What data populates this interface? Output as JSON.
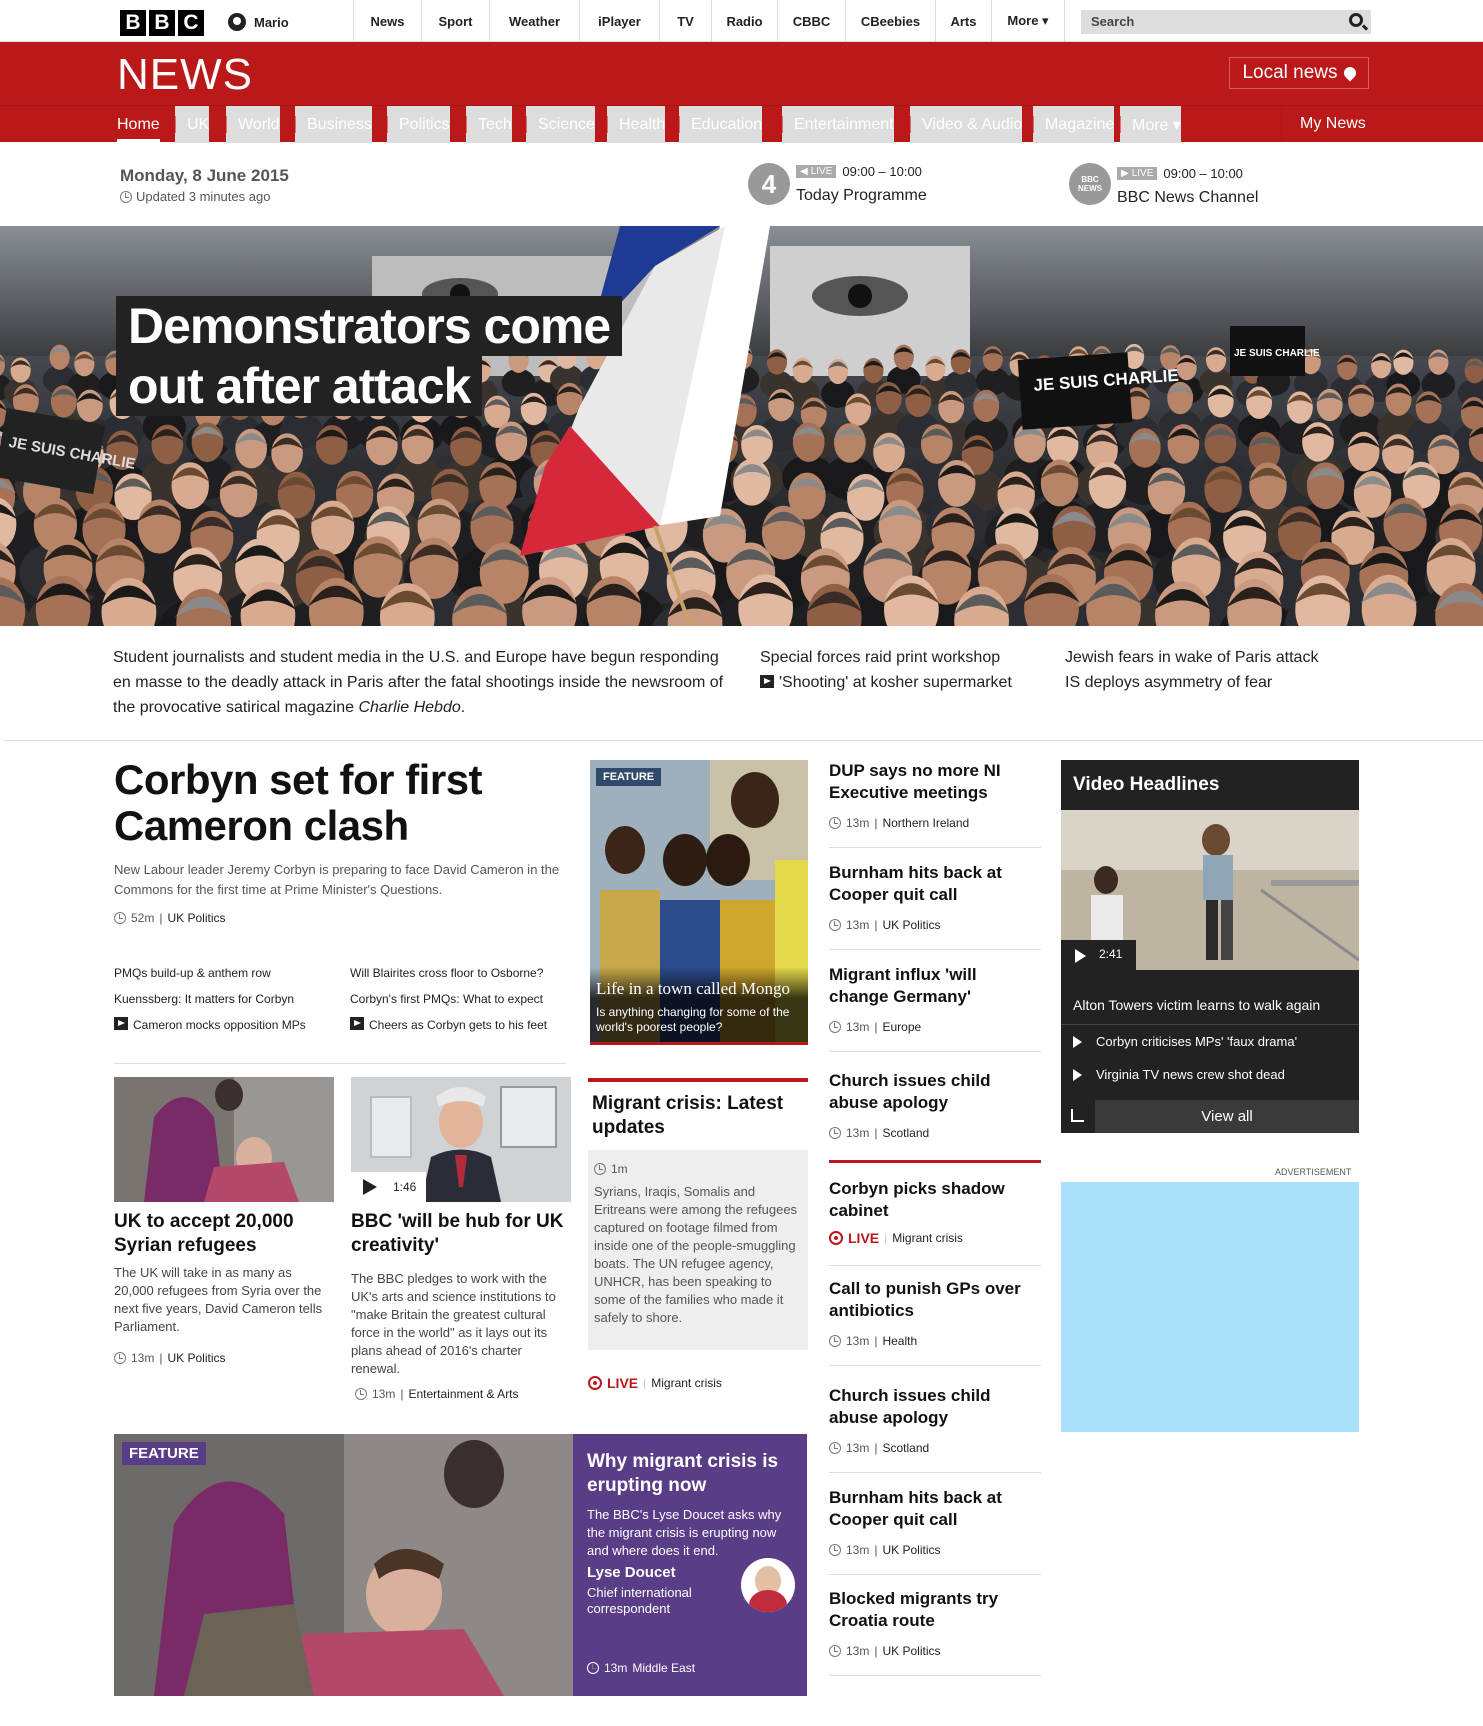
{
  "topbar": {
    "logo_letters": [
      "B",
      "B",
      "C"
    ],
    "account_name": "Mario",
    "nav": [
      {
        "label": "News",
        "w": 68
      },
      {
        "label": "Sport",
        "w": 68
      },
      {
        "label": "Weather",
        "w": 90
      },
      {
        "label": "iPlayer",
        "w": 80
      },
      {
        "label": "TV",
        "w": 52
      },
      {
        "label": "Radio",
        "w": 66
      },
      {
        "label": "CBBC",
        "w": 68
      },
      {
        "label": "CBeebies",
        "w": 90
      },
      {
        "label": "Arts",
        "w": 56
      },
      {
        "label": "More ▾",
        "w": 74
      }
    ],
    "search_placeholder": "Search"
  },
  "masthead": {
    "title": "NEWS",
    "local_news": "Local news",
    "nav": [
      "Home",
      "UK",
      "World",
      "Business",
      "Politics",
      "Tech",
      "Science",
      "Health",
      "Education",
      "Entertainment",
      "Video & Audio",
      "Magazine",
      "More ▾"
    ],
    "my_news": "My News"
  },
  "datebar": {
    "date": "Monday, 8 June 2015",
    "updated": "Updated 3 minutes ago",
    "radio": {
      "badge": "LIVE",
      "time": "09:00 – 10:00",
      "programme": "Today Programme",
      "logo": "4"
    },
    "tv": {
      "badge": "LIVE",
      "time": "09:00 – 10:00",
      "programme": "BBC News Channel",
      "logo": "BBC NEWS"
    }
  },
  "hero": {
    "headline_line1": "Demonstrators come",
    "headline_line2": "out after attack",
    "summary_pre": "Student journalists and student media in the U.S. and Europe have begun responding en masse to the deadly attack in Paris after the fatal shootings inside the newsroom of the provocative satirical magazine ",
    "summary_em": "Charlie Hebdo",
    "summary_post": ".",
    "related_col1": [
      "Special forces raid print workshop",
      "'Shooting' at kosher supermarket"
    ],
    "related_col2": [
      "Jewish fears in wake of Paris attack",
      "IS deploys asymmetry of fear"
    ],
    "sign_texts": [
      "JE SUIS CHARLIE",
      "JE SUIS CHARLIE",
      "JE SUIS CHARLIE"
    ]
  },
  "lead": {
    "headline": "Corbyn set for first Cameron clash",
    "summary": "New Labour leader Jeremy Corbyn is preparing to face David Cameron in the Commons for the first time at Prime Minister's Questions.",
    "time": "52m",
    "section": "UK Politics",
    "links_col1": [
      "PMQs build-up & anthem row",
      "Kuenssberg: It matters for Corbyn",
      "Cameron mocks opposition MPs"
    ],
    "links_col2": [
      "Will Blairites cross floor to Osborne?",
      "Corbyn's first PMQs: What to expect",
      "Cheers as Corbyn gets to his feet"
    ]
  },
  "feature_mongo": {
    "badge": "FEATURE",
    "title": "Life in a town called Mongo",
    "subtitle": "Is anything changing for some of the world's poorest people?"
  },
  "story_list": [
    {
      "headline": "DUP says no more NI Executive meetings",
      "time": "13m",
      "section": "Northern Ireland"
    },
    {
      "headline": "Burnham hits back at Cooper quit call",
      "time": "13m",
      "section": "UK Politics"
    },
    {
      "headline": "Migrant influx 'will change Germany'",
      "time": "13m",
      "section": "Europe"
    },
    {
      "headline": "Church issues child abuse apology",
      "time": "13m",
      "section": "Scotland"
    },
    {
      "headline": "Corbyn picks shadow cabinet",
      "live": "LIVE",
      "section": "Migrant crisis"
    },
    {
      "headline": "Call to punish GPs over antibiotics",
      "time": "13m",
      "section": "Health"
    },
    {
      "headline": "Church issues child abuse apology",
      "time": "13m",
      "section": "Scotland"
    },
    {
      "headline": "Burnham hits back at Cooper quit call",
      "time": "13m",
      "section": "UK Politics"
    },
    {
      "headline": "Blocked migrants try Croatia route",
      "time": "13m",
      "section": "UK Politics"
    }
  ],
  "video_headlines": {
    "title": "Video Headlines",
    "duration": "2:41",
    "caption": "Alton Towers victim learns to walk again",
    "items": [
      "Corbyn criticises MPs' 'faux drama'",
      "Virginia TV news crew shot dead"
    ],
    "view_all": "View all"
  },
  "advert_label": "ADVERTISEMENT",
  "refugees": {
    "headline": "UK to accept 20,000 Syrian refugees",
    "summary": "The UK will take in as many as 20,000 refugees from Syria over the next five years, David Cameron tells Parliament.",
    "time": "13m",
    "section": "UK Politics"
  },
  "bbc_hub": {
    "headline": "BBC 'will be hub for UK creativity'",
    "duration": "1:46",
    "summary": "The BBC pledges to work with the UK's arts and science institutions to \"make Britain the greatest cultural force in the world\" as it lays out its plans ahead of 2016's charter renewal.",
    "time": "13m",
    "section": "Entertainment & Arts"
  },
  "migrant_live": {
    "headline": "Migrant crisis: Latest updates",
    "time": "1m",
    "body": "Syrians, Iraqis, Somalis and Eritreans were among the refugees captured on footage filmed from inside one of the people-smuggling boats. The UN refugee agency, UNHCR, has been speaking to some of the families who made it safely to shore.",
    "live": "LIVE",
    "section": "Migrant crisis"
  },
  "feature_migrant": {
    "badge": "FEATURE",
    "headline": "Why migrant crisis is erupting now",
    "summary": "The BBC's Lyse Doucet asks why the migrant crisis is erupting now and where does it end.",
    "author": "Lyse Doucet",
    "role": "Chief international correspondent",
    "time": "13m",
    "section": "Middle East"
  },
  "colors": {
    "bbc_red": "#bb1919",
    "feature_purple": "#5a3d87",
    "advert_blue": "#a9e1fb"
  }
}
